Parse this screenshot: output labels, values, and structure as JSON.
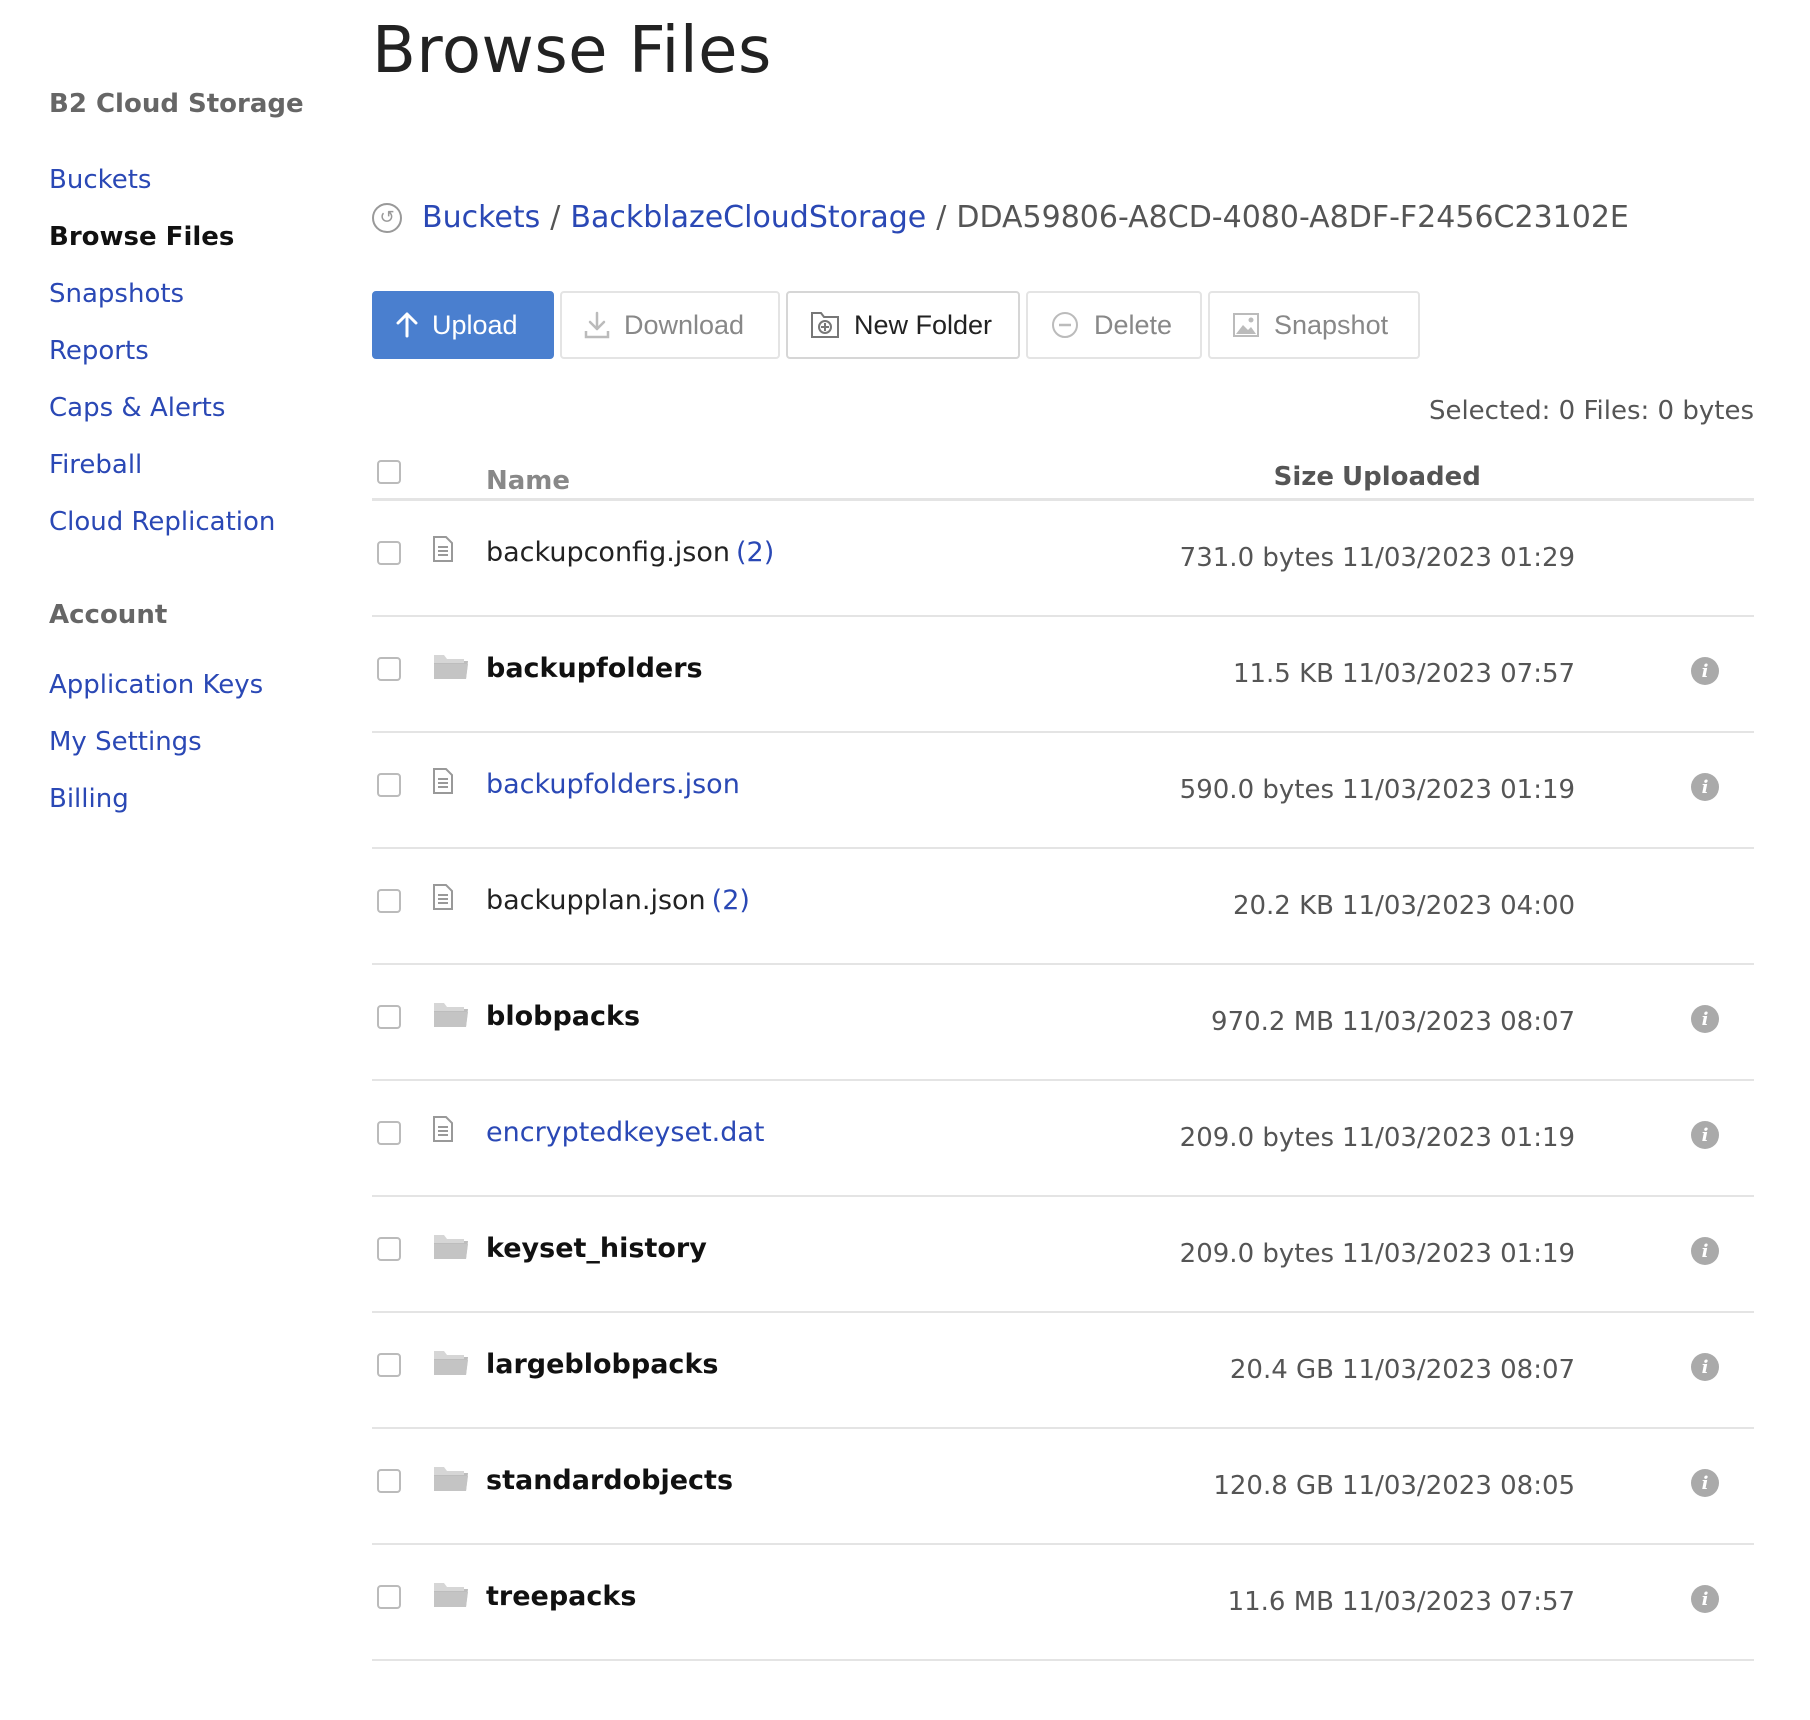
{
  "sidebar": {
    "section_storage": "B2 Cloud Storage",
    "storage_items": [
      "Buckets",
      "Browse Files",
      "Snapshots",
      "Reports",
      "Caps & Alerts",
      "Fireball",
      "Cloud Replication"
    ],
    "active_item": "Browse Files",
    "section_account": "Account",
    "account_items": [
      "Application Keys",
      "My Settings",
      "Billing"
    ]
  },
  "page": {
    "title": "Browse Files"
  },
  "breadcrumb": {
    "root": "Buckets",
    "sep": "/",
    "bucket": "BackblazeCloudStorage",
    "current": "DDA59806-A8CD-4080-A8DF-F2456C23102E"
  },
  "toolbar": {
    "upload": "Upload",
    "download": "Download",
    "new_folder": "New Folder",
    "delete": "Delete",
    "snapshot": "Snapshot"
  },
  "selection": {
    "summary": "Selected: 0 Files: 0 bytes"
  },
  "table": {
    "columns": {
      "name": "Name",
      "size": "Size",
      "uploaded": "Uploaded"
    },
    "rows": [
      {
        "type": "file",
        "name": "backupconfig.json",
        "versions": "(2)",
        "size": "731.0 bytes",
        "uploaded": "11/03/2023 01:29",
        "info": false,
        "link": false
      },
      {
        "type": "folder",
        "name": "backupfolders",
        "versions": "",
        "size": "11.5 KB",
        "uploaded": "11/03/2023 07:57",
        "info": true,
        "link": false
      },
      {
        "type": "file",
        "name": "backupfolders.json",
        "versions": "",
        "size": "590.0 bytes",
        "uploaded": "11/03/2023 01:19",
        "info": true,
        "link": true
      },
      {
        "type": "file",
        "name": "backupplan.json",
        "versions": "(2)",
        "size": "20.2 KB",
        "uploaded": "11/03/2023 04:00",
        "info": false,
        "link": false
      },
      {
        "type": "folder",
        "name": "blobpacks",
        "versions": "",
        "size": "970.2 MB",
        "uploaded": "11/03/2023 08:07",
        "info": true,
        "link": false
      },
      {
        "type": "file",
        "name": "encryptedkeyset.dat",
        "versions": "",
        "size": "209.0 bytes",
        "uploaded": "11/03/2023 01:19",
        "info": true,
        "link": true
      },
      {
        "type": "folder",
        "name": "keyset_history",
        "versions": "",
        "size": "209.0 bytes",
        "uploaded": "11/03/2023 01:19",
        "info": true,
        "link": false
      },
      {
        "type": "folder",
        "name": "largeblobpacks",
        "versions": "",
        "size": "20.4 GB",
        "uploaded": "11/03/2023 08:07",
        "info": true,
        "link": false
      },
      {
        "type": "folder",
        "name": "standardobjects",
        "versions": "",
        "size": "120.8 GB",
        "uploaded": "11/03/2023 08:05",
        "info": true,
        "link": false
      },
      {
        "type": "folder",
        "name": "treepacks",
        "versions": "",
        "size": "11.6 MB",
        "uploaded": "11/03/2023 07:57",
        "info": true,
        "link": false
      }
    ]
  },
  "icons": {
    "back": "refresh-back-icon",
    "upload": "arrow-up-icon",
    "download": "download-icon",
    "new_folder": "folder-plus-icon",
    "delete": "minus-circle-icon",
    "snapshot": "image-icon",
    "file": "file-icon",
    "folder": "folder-icon",
    "info": "info-icon",
    "info_glyph": "i"
  },
  "colors": {
    "accent": "#4a7fcf",
    "link": "#2a48b5"
  }
}
